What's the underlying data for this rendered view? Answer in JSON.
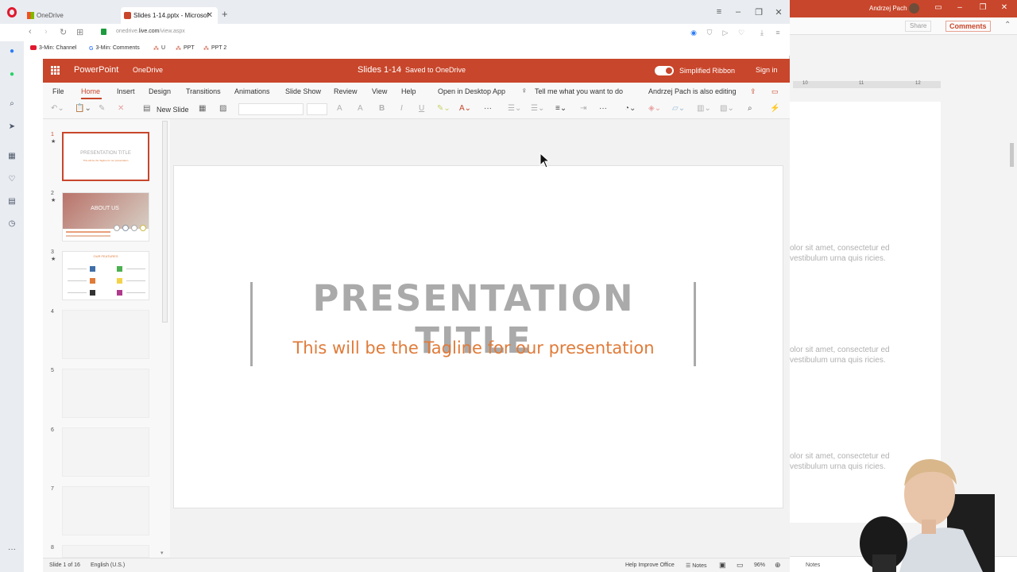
{
  "browser": {
    "tabs": [
      {
        "label": "OneDrive"
      },
      {
        "label": "Slides 1-14.pptx - Microsof"
      }
    ],
    "url_prefix": "onedrive.",
    "url_host": "live.com",
    "url_path": "/view.aspx",
    "bookmarks": [
      "3-Min: Channel",
      "3-Min: Comments",
      "U",
      "PPT",
      "PPT 2"
    ]
  },
  "ppt": {
    "app_name": "PowerPoint",
    "onedrive": "OneDrive",
    "doc_title": "Slides 1-14",
    "saved_status": "Saved to OneDrive",
    "simplified_ribbon": "Simplified Ribbon",
    "sign_in": "Sign in",
    "menu": [
      "File",
      "Home",
      "Insert",
      "Design",
      "Transitions",
      "Animations",
      "Slide Show",
      "Review",
      "View",
      "Help",
      "Open in Desktop App"
    ],
    "tell_me": "Tell me what you want to do",
    "coauthor": "Andrzej Pach is also editing",
    "new_slide": "New Slide",
    "accent_color": "#c8462b"
  },
  "thumbnails": {
    "numbers": [
      "1",
      "2",
      "3",
      "4",
      "5",
      "6",
      "7",
      "8"
    ],
    "slide1_title": "PRESENTATION TITLE",
    "slide1_subtitle": "This will be the Tagline for our presentation",
    "slide2_title": "ABOUT US",
    "slide3_title": "OUR FEATURES"
  },
  "slide": {
    "title": "PRESENTATION TITLE",
    "tagline": "This will be the Tagline for our presentation",
    "title_color": "#aaaaaa",
    "tagline_color": "#e07b39"
  },
  "status": {
    "slide_count": "Slide 1 of 16",
    "language": "English (U.S.)",
    "help_improve": "Help Improve Office",
    "notes": "Notes",
    "zoom": "96%"
  },
  "bg_window": {
    "user": "Andrzej Pach",
    "share": "Share",
    "comments": "Comments",
    "ruler": [
      "10",
      "11",
      "12"
    ],
    "text_blocks": [
      "olor sit amet, consectetur ed vestibulum urna quis ricies.",
      "olor sit amet, consectetur ed vestibulum urna quis ricies.",
      "olor sit amet, consectetur ed vestibulum urna quis ricies."
    ],
    "notes": "Notes"
  }
}
